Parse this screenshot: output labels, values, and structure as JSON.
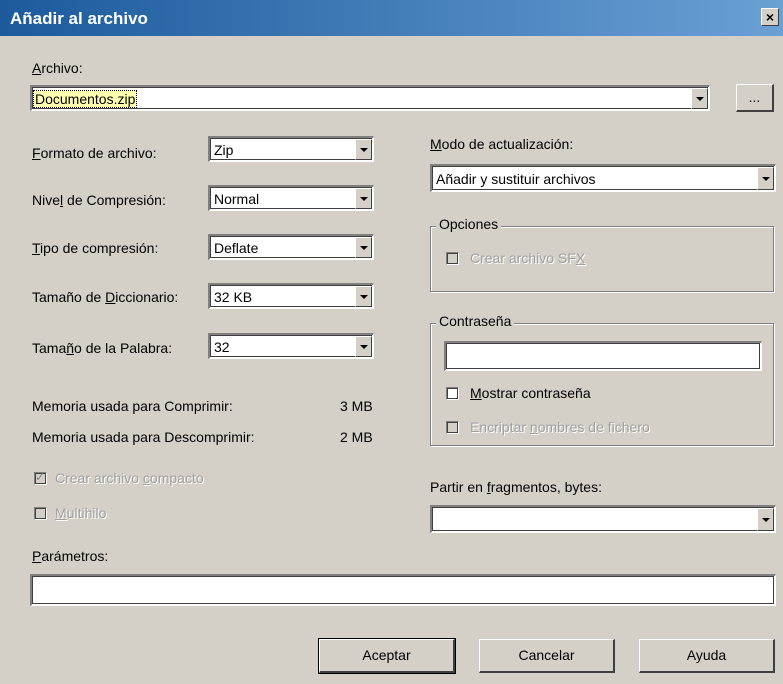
{
  "window": {
    "title": "Añadir al archivo",
    "close_glyph": "×"
  },
  "archivo": {
    "label_u": "A",
    "label_rest": "rchivo:",
    "value": "Documentos.zip",
    "browse_label": "..."
  },
  "left": {
    "formato": {
      "label_u": "F",
      "label_rest": "ormato de archivo:",
      "value": "Zip"
    },
    "nivel": {
      "label_pre": "Nive",
      "label_u": "l",
      "label_rest": " de Compresión:",
      "value": "Normal"
    },
    "tipo": {
      "label_u": "T",
      "label_rest": "ipo de compresión:",
      "value": "Deflate"
    },
    "diccionario": {
      "label_pre": "Tamaño de ",
      "label_u": "D",
      "label_rest": "iccionario:",
      "value": "32 KB"
    },
    "palabra": {
      "label_pre": "Tama",
      "label_u": "ñ",
      "label_rest": "o de la Palabra:",
      "value": "32"
    },
    "mem_comprimir": {
      "label": "Memoria usada para Comprimir:",
      "value": "3 MB"
    },
    "mem_descomprimir": {
      "label": "Memoria usada para Descomprimir:",
      "value": "2 MB"
    },
    "compacto": {
      "label_pre": "Crear archivo ",
      "label_u": "c",
      "label_rest": "ompacto",
      "checked": true
    },
    "multihilo": {
      "label_pre": "",
      "label_u": "M",
      "label_rest": "ultihilo",
      "checked": false
    }
  },
  "right": {
    "modo": {
      "label_u": "M",
      "label_rest": "odo de actualización:",
      "value": "Añadir y sustituir archivos"
    },
    "opciones": {
      "title": "Opciones",
      "sfx_pre": "Crear archivo SF",
      "sfx_u": "X",
      "sfx_rest": ""
    },
    "password": {
      "title": "Contraseña",
      "value": "",
      "mostrar_u": "M",
      "mostrar_rest": "ostrar contraseña",
      "encriptar_pre": "Encriptar ",
      "encriptar_u": "n",
      "encriptar_rest": "ombres de fichero"
    },
    "partir": {
      "label_pre": "Partir en ",
      "label_u": "f",
      "label_rest": "ragmentos, bytes:",
      "value": ""
    }
  },
  "parametros": {
    "label_u": "P",
    "label_rest": "arámetros:",
    "value": ""
  },
  "buttons": {
    "aceptar": "Aceptar",
    "cancelar": "Cancelar",
    "ayuda": "Ayuda"
  }
}
